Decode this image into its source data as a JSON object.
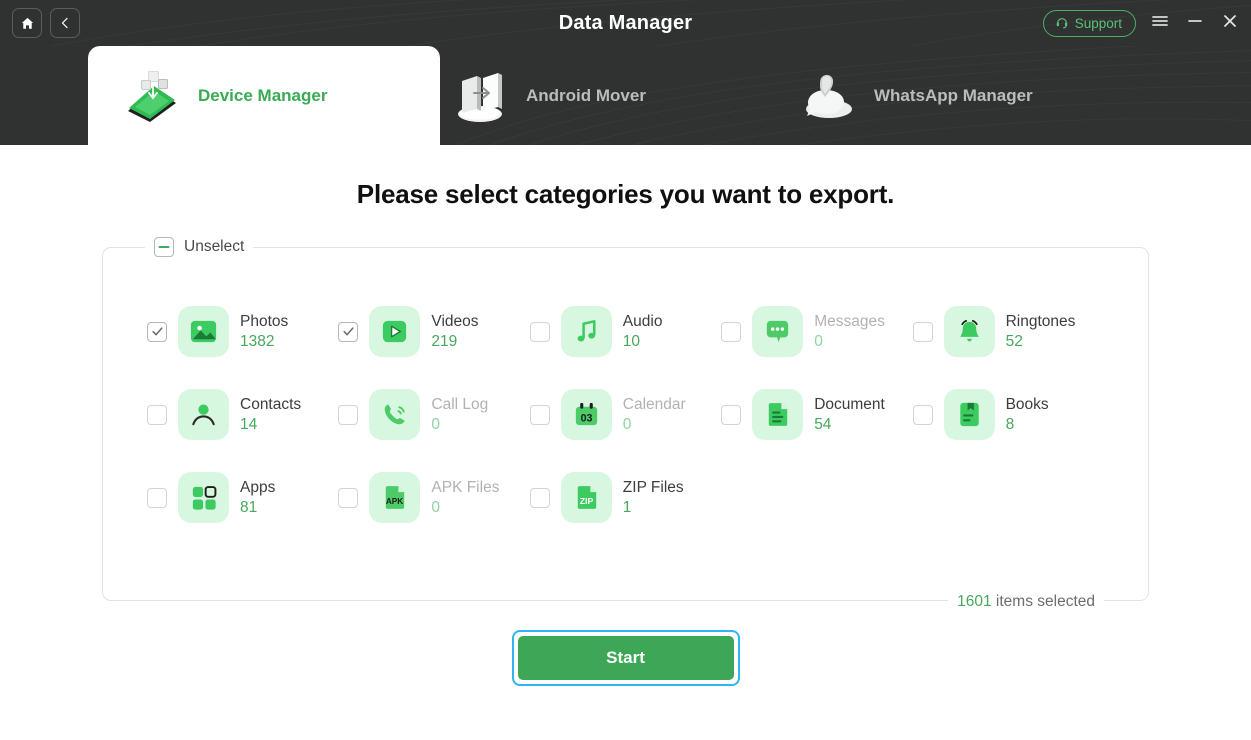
{
  "window": {
    "title": "Data Manager",
    "home_icon": "home-icon",
    "back_icon": "chevron-left-icon",
    "support_label": "Support",
    "support_icon": "headset-icon",
    "menu_icon": "hamburger-menu-icon",
    "minimize_icon": "minimize-icon",
    "close_icon": "close-icon",
    "accent_green": "#3aab55",
    "header_bg": "#2f3231"
  },
  "tabs": [
    {
      "label": "Device Manager",
      "icon": "phone-transfer-icon",
      "active": true
    },
    {
      "label": "Android Mover",
      "icon": "folder-transfer-icon",
      "active": false
    },
    {
      "label": "WhatsApp Manager",
      "icon": "whatsapp-chat-icon",
      "active": false
    }
  ],
  "main": {
    "headline": "Please select categories you want to export.",
    "select_all": {
      "label": "Unselect",
      "state": "indeterminate"
    },
    "categories": [
      {
        "name": "Photos",
        "count": "1382",
        "icon": "photo-icon",
        "checked": true,
        "dim": false
      },
      {
        "name": "Videos",
        "count": "219",
        "icon": "video-icon",
        "checked": true,
        "dim": false
      },
      {
        "name": "Audio",
        "count": "10",
        "icon": "music-icon",
        "checked": false,
        "dim": false
      },
      {
        "name": "Messages",
        "count": "0",
        "icon": "message-icon",
        "checked": false,
        "dim": true
      },
      {
        "name": "Ringtones",
        "count": "52",
        "icon": "bell-icon",
        "checked": false,
        "dim": false
      },
      {
        "name": "Contacts",
        "count": "14",
        "icon": "contact-icon",
        "checked": false,
        "dim": false
      },
      {
        "name": "Call Log",
        "count": "0",
        "icon": "phone-call-icon",
        "checked": false,
        "dim": true
      },
      {
        "name": "Calendar",
        "count": "0",
        "icon": "calendar-icon",
        "checked": false,
        "dim": true
      },
      {
        "name": "Document",
        "count": "54",
        "icon": "document-icon",
        "checked": false,
        "dim": false
      },
      {
        "name": "Books",
        "count": "8",
        "icon": "book-icon",
        "checked": false,
        "dim": false
      },
      {
        "name": "Apps",
        "count": "81",
        "icon": "apps-grid-icon",
        "checked": false,
        "dim": false
      },
      {
        "name": "APK Files",
        "count": "0",
        "icon": "apk-file-icon",
        "checked": false,
        "dim": true
      },
      {
        "name": "ZIP Files",
        "count": "1",
        "icon": "zip-file-icon",
        "checked": false,
        "dim": false
      }
    ],
    "selected_summary": {
      "count": "1601",
      "suffix": "items selected"
    },
    "start_label": "Start"
  }
}
